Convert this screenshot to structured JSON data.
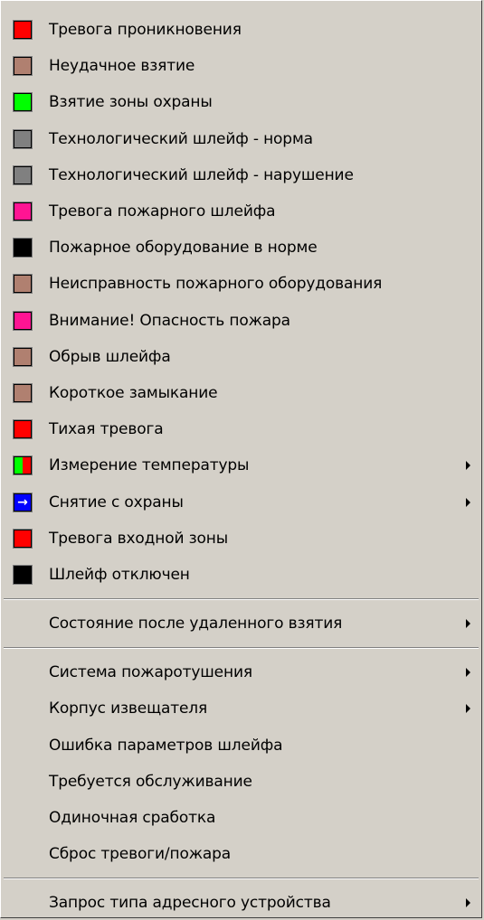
{
  "menu": {
    "group1": [
      {
        "label": "Тревога проникновения",
        "icon": "red-square-icon",
        "color": "#ff0000",
        "submenu": false
      },
      {
        "label": "Неудачное взятие",
        "icon": "brown-square-icon",
        "color": "#b08070",
        "submenu": false
      },
      {
        "label": "Взятие зоны охраны",
        "icon": "green-square-icon",
        "color": "#00ff00",
        "submenu": false
      },
      {
        "label": "Технологический шлейф - норма",
        "icon": "gray-square-icon",
        "color": "#808080",
        "submenu": false
      },
      {
        "label": "Технологический шлейф - нарушение",
        "icon": "gray-square-icon",
        "color": "#808080",
        "submenu": false
      },
      {
        "label": "Тревога пожарного шлейфа",
        "icon": "pink-square-icon",
        "color": "#ff1493",
        "submenu": false
      },
      {
        "label": "Пожарное оборудование в норме",
        "icon": "black-square-icon",
        "color": "#000000",
        "submenu": false
      },
      {
        "label": "Неисправность пожарного оборудования",
        "icon": "brown-square-icon",
        "color": "#b08070",
        "submenu": false
      },
      {
        "label": "Внимание! Опасность пожара",
        "icon": "pink-square-icon",
        "color": "#ff1493",
        "submenu": false
      },
      {
        "label": "Обрыв шлейфа",
        "icon": "brown-square-icon",
        "color": "#b08070",
        "submenu": false
      },
      {
        "label": "Короткое замыкание",
        "icon": "brown-square-icon",
        "color": "#b08070",
        "submenu": false
      },
      {
        "label": "Тихая тревога",
        "icon": "red-square-icon",
        "color": "#ff0000",
        "submenu": false
      },
      {
        "label": "Измерение температуры",
        "icon": "green-red-split-icon",
        "color": "#00ff00",
        "color2": "#ff0000",
        "submenu": true
      },
      {
        "label": "Снятие с охраны",
        "icon": "blue-enter-arrow-icon",
        "color": "#0000ff",
        "glyph": "→",
        "submenu": true
      },
      {
        "label": "Тревога входной зоны",
        "icon": "red-square-icon",
        "color": "#ff0000",
        "submenu": false
      },
      {
        "label": "Шлейф отключен",
        "icon": "black-square-icon",
        "color": "#000000",
        "submenu": false
      }
    ],
    "group2": [
      {
        "label": "Состояние после удаленного взятия",
        "submenu": true
      }
    ],
    "group3": [
      {
        "label": "Система пожаротушения",
        "submenu": true
      },
      {
        "label": "Корпус извещателя",
        "submenu": true
      },
      {
        "label": "Ошибка параметров шлейфа",
        "submenu": false
      },
      {
        "label": "Требуется обслуживание",
        "submenu": false
      },
      {
        "label": "Одиночная сработка",
        "submenu": false
      },
      {
        "label": "Сброс тревоги/пожара",
        "submenu": false
      }
    ],
    "group4": [
      {
        "label": "Запрос типа адресного устройства",
        "submenu": true
      }
    ]
  }
}
